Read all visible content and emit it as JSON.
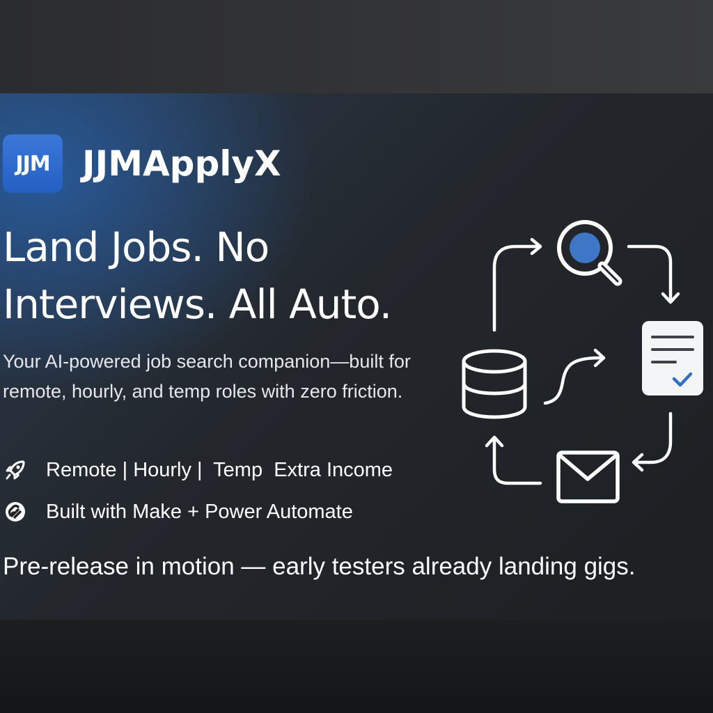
{
  "brand": {
    "logo_text": "JJM",
    "name": "JJMApplyX",
    "accent_color": "#2a6acb"
  },
  "headline": "Land Jobs. No Interviews. All Auto.",
  "subtitle": "Your AI-powered job search companion—built for remote, hourly, and temp roles with zero friction.",
  "features": [
    {
      "icon": "rocket-icon",
      "text": "Remote | Hourly |  Temp  Extra Income"
    },
    {
      "icon": "link-icon",
      "text": "Built with Make + Power Automate"
    }
  ],
  "tagline": "Pre-release in motion — early testers already landing gigs.",
  "flow_icons": [
    "search-icon",
    "document-check-icon",
    "mail-icon",
    "database-icon"
  ]
}
